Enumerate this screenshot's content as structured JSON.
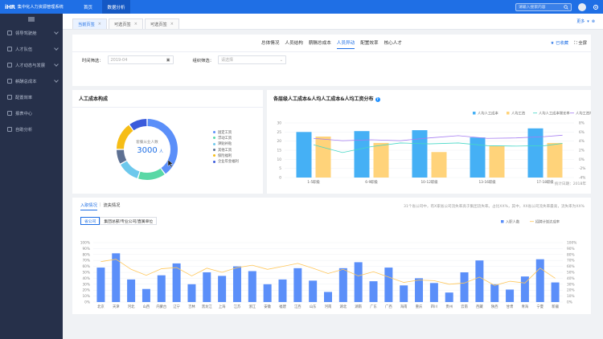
{
  "app": {
    "logo": "iHR",
    "title": "集中化人力资源管理系统"
  },
  "topnav": {
    "items": [
      {
        "label": "首页"
      },
      {
        "label": "数据分析"
      }
    ],
    "active": 1
  },
  "search": {
    "placeholder": "请输入搜索内容"
  },
  "sidebar": {
    "items": [
      {
        "label": "领导驾驶舱"
      },
      {
        "label": "人才队伍"
      },
      {
        "label": "人才动态与发展"
      },
      {
        "label": "薪酬总成本"
      },
      {
        "label": "配置效率"
      },
      {
        "label": "报表中心"
      },
      {
        "label": "自助分析"
      }
    ]
  },
  "pagetabs": {
    "items": [
      {
        "label": "当前页签"
      },
      {
        "label": "可选页签"
      },
      {
        "label": "可选页签"
      }
    ],
    "more": "更多"
  },
  "subnav": {
    "tabs": [
      {
        "label": "总体情况"
      },
      {
        "label": "人员结构"
      },
      {
        "label": "薪酬总成本"
      },
      {
        "label": "人员异动"
      },
      {
        "label": "配置效率"
      },
      {
        "label": "核心人才"
      }
    ],
    "active": 3,
    "fav": "已收藏",
    "fullscreen": "全屏",
    "time_label": "时间筛选：",
    "time_value": "2019-04",
    "org_label": "组织筛选：",
    "org_placeholder": "请选择"
  },
  "pie": {
    "title": "人工成本构成",
    "center_label": "套餐从业人数",
    "center_value": "3000",
    "center_unit": "人",
    "legend": [
      "固定工资",
      "浮动工资",
      "津贴补贴",
      "其他工资",
      "保险福利",
      "企业年金福利"
    ]
  },
  "barchart": {
    "title": "各层级人工成本&人均人工成本&人均工资分布",
    "legend": [
      "人均人工成本",
      "人均工资",
      "人均人工成本增长率",
      "人均工资增长率"
    ],
    "note": "统计日期：2018年"
  },
  "lower": {
    "tabs": [
      "入职情况",
      "流失情况"
    ],
    "separator": "|",
    "btns": [
      "省公司",
      "集团总部/专业公司/直属单位"
    ],
    "note": "31个省公司中，有X家省公司流失率高于集团流失率。占比XX%，其中，XX省公司流失率最高，流失率为XX%",
    "legend": [
      "入职人数",
      "招聘计划达成率"
    ]
  },
  "colors": {
    "primary": "#1f6fe5",
    "bar_blue": "#5b8ff9",
    "bar_cyan": "#45b0f5",
    "bar_yellow": "#ffd37a"
  },
  "chart_data": [
    {
      "type": "pie",
      "title": "人工成本构成",
      "labels": [
        "固定工资",
        "浮动工资",
        "津贴补贴",
        "其他工资",
        "保险福利",
        "企业年金福利"
      ],
      "values": [
        40,
        15,
        12,
        8,
        15,
        10
      ],
      "colors": [
        "#5b8ff9",
        "#5ad8a6",
        "#6dc8ec",
        "#5d7092",
        "#f6bd16",
        "#3b5bdb"
      ]
    },
    {
      "type": "bar",
      "title": "各层级人工成本&人均人工成本&人均工资分布",
      "categories": [
        "1-5职级",
        "6-9职级",
        "10-12职级",
        "13-16职级",
        "17-18职级"
      ],
      "series": [
        {
          "name": "人均人工成本",
          "values": [
            25,
            25.5,
            26,
            22,
            27
          ],
          "color": "#45b0f5"
        },
        {
          "name": "人均工资",
          "values": [
            22.5,
            19,
            14,
            17.5,
            19
          ],
          "color": "#ffd37a"
        }
      ],
      "lines": [
        {
          "name": "人均人工成本增长率",
          "x": [
            0,
            0.5,
            1,
            1.5,
            2,
            2.5,
            3,
            3.5,
            4,
            4.3
          ],
          "values": [
            3.2,
            1.5,
            2.8,
            3.6,
            3.4,
            3.6,
            3.0,
            2.9,
            3.0,
            3.5
          ],
          "color": "#45d7c6"
        },
        {
          "name": "人均工资增长率",
          "x": [
            0,
            0.5,
            1,
            1.5,
            2,
            2.5,
            3,
            3.5,
            4,
            4.3
          ],
          "values": [
            4.6,
            4.1,
            4.3,
            4.1,
            4.7,
            5.2,
            4.6,
            4.7,
            5.0,
            5.3
          ],
          "color": "#a57cf2"
        }
      ],
      "ylim_left": [
        0,
        30
      ],
      "yticks_left": [
        0,
        5,
        10,
        15,
        20,
        25,
        30
      ],
      "ylim_right": [
        -4,
        8
      ],
      "yticks_right": [
        "-4%",
        "-2%",
        "0%",
        "2%",
        "4%",
        "6%",
        "8%"
      ]
    },
    {
      "type": "bar",
      "title": "",
      "categories": [
        "北京",
        "天津",
        "河北",
        "山西",
        "内蒙古",
        "辽宁",
        "吉林",
        "黑龙江",
        "上海",
        "江苏",
        "浙江",
        "安徽",
        "福建",
        "江西",
        "山东",
        "河南",
        "湖北",
        "湖南",
        "广东",
        "广西",
        "海南",
        "重庆",
        "四川",
        "贵州",
        "云南",
        "西藏",
        "陕西",
        "甘肃",
        "青海",
        "宁夏",
        "新疆"
      ],
      "series": [
        {
          "name": "入职人数",
          "values": [
            58,
            82,
            38,
            22,
            45,
            65,
            30,
            50,
            44,
            60,
            52,
            30,
            38,
            57,
            36,
            17,
            57,
            67,
            35,
            58,
            28,
            40,
            32,
            16,
            50,
            70,
            30,
            21,
            43,
            72,
            33
          ],
          "color": "#5b8ff9"
        },
        {
          "name": "招聘计划达成率",
          "values": [
            68,
            72,
            55,
            45,
            56,
            58,
            44,
            57,
            50,
            58,
            62,
            55,
            60,
            65,
            57,
            48,
            55,
            44,
            51,
            42,
            33,
            37,
            36,
            30,
            32,
            42,
            28,
            35,
            32,
            57,
            40
          ],
          "color": "#ffc75a"
        }
      ],
      "ylim": [
        0,
        100
      ],
      "yticks": [
        "0%",
        "10%",
        "20%",
        "30%",
        "40%",
        "50%",
        "60%",
        "70%",
        "80%",
        "90%",
        "100%"
      ]
    }
  ]
}
